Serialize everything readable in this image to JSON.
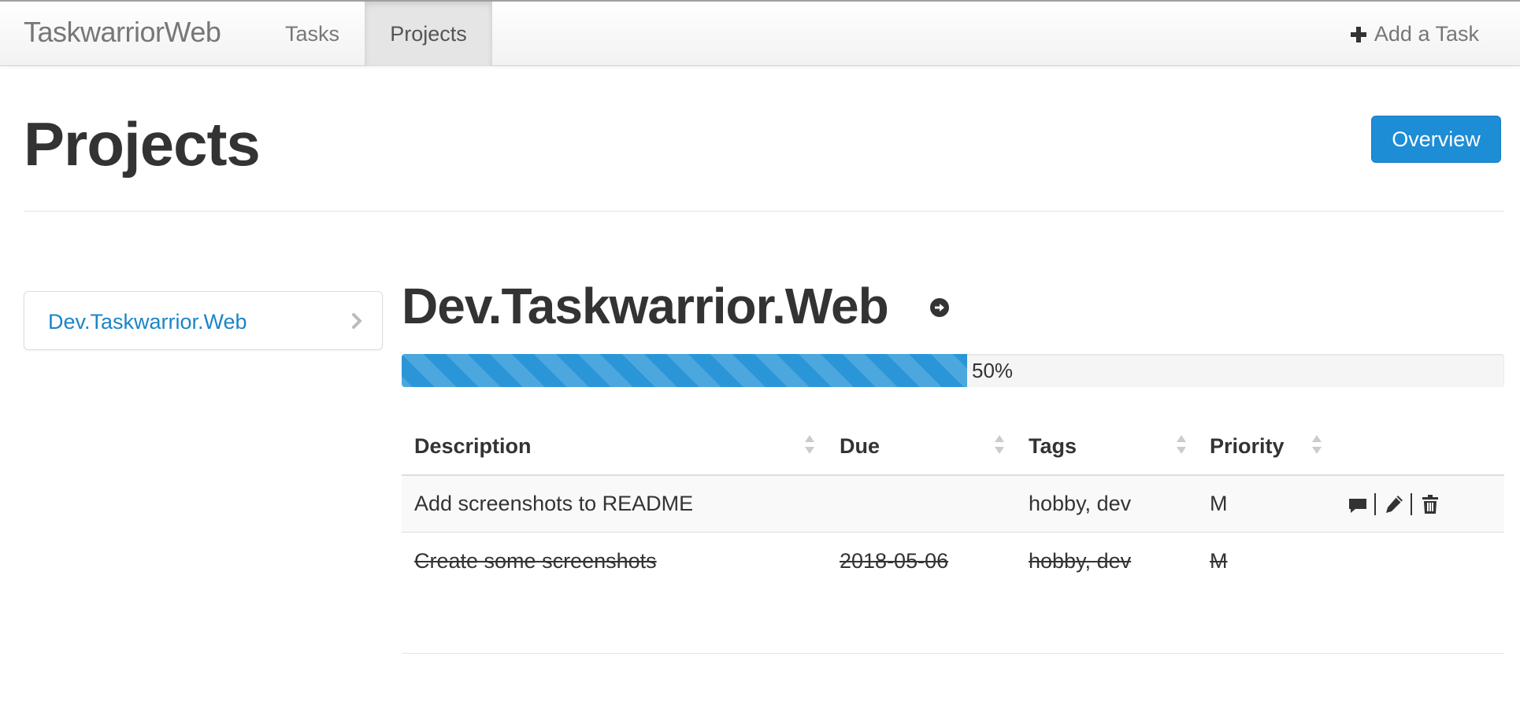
{
  "navbar": {
    "brand": "TaskwarriorWeb",
    "links": [
      {
        "label": "Tasks",
        "active": false
      },
      {
        "label": "Projects",
        "active": true
      }
    ],
    "add_task": {
      "label": "Add a Task",
      "icon": "plus-icon"
    }
  },
  "header": {
    "title": "Projects",
    "overview_button": "Overview"
  },
  "sidebar": {
    "items": [
      {
        "label": "Dev.Taskwarrior.Web",
        "icon": "chevron-right-icon"
      }
    ]
  },
  "project": {
    "name": "Dev.Taskwarrior.Web",
    "goto_icon": "circle-arrow-right-icon",
    "progress_percent": 50,
    "progress_label": "50%",
    "table": {
      "columns": [
        "Description",
        "Due",
        "Tags",
        "Priority"
      ],
      "rows": [
        {
          "description": "Add screenshots to README",
          "due": "",
          "tags": "hobby, dev",
          "priority": "M",
          "completed": false,
          "actions": [
            "comment-icon",
            "pencil-icon",
            "trash-icon"
          ]
        },
        {
          "description": "Create some screenshots",
          "due": "2018-05-06",
          "tags": "hobby, dev",
          "priority": "M",
          "completed": true
        }
      ]
    }
  },
  "colors": {
    "accent": "#1d8dd6",
    "link": "#1a85c8",
    "progress_fill": "#2a96d8"
  }
}
